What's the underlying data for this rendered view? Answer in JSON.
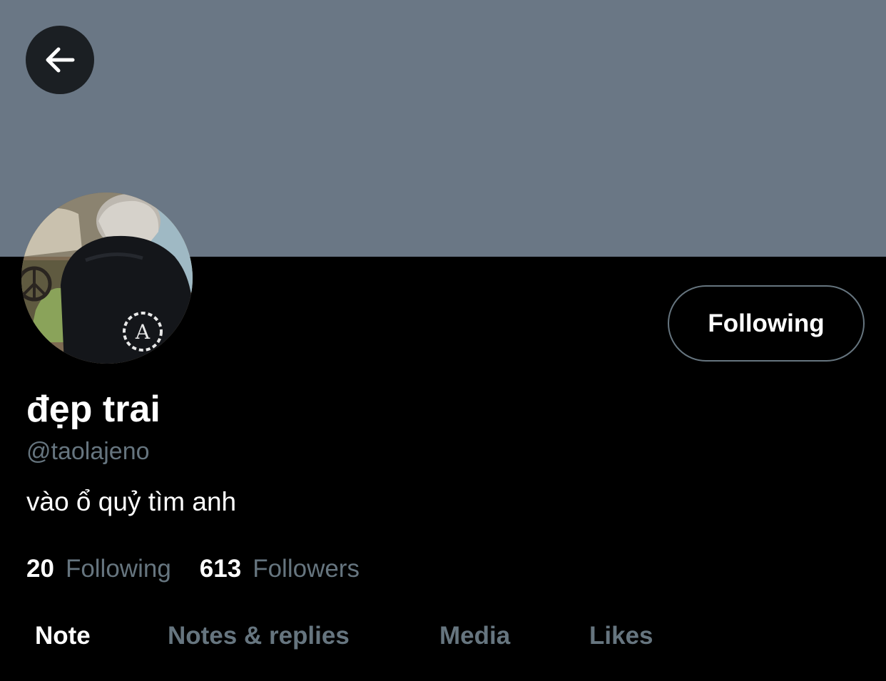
{
  "colors": {
    "banner": "#6a7785",
    "background": "#000000",
    "primary_text": "#ffffff",
    "secondary_text": "#66757f",
    "back_button_bg": "#1b1f23",
    "follow_button_border": "#66757f"
  },
  "header": {
    "back_icon": "arrow-left-icon"
  },
  "profile": {
    "display_name": "đẹp trai",
    "handle": "@taolajeno",
    "bio": "vào ổ quỷ tìm anh",
    "follow_button_label": "Following"
  },
  "stats": {
    "following_count": "20",
    "following_label": "Following",
    "followers_count": "613",
    "followers_label": "Followers"
  },
  "tabs": [
    {
      "label": "Note",
      "active": true
    },
    {
      "label": "Notes & replies",
      "active": false
    },
    {
      "label": "Media",
      "active": false
    },
    {
      "label": "Likes",
      "active": false
    }
  ]
}
